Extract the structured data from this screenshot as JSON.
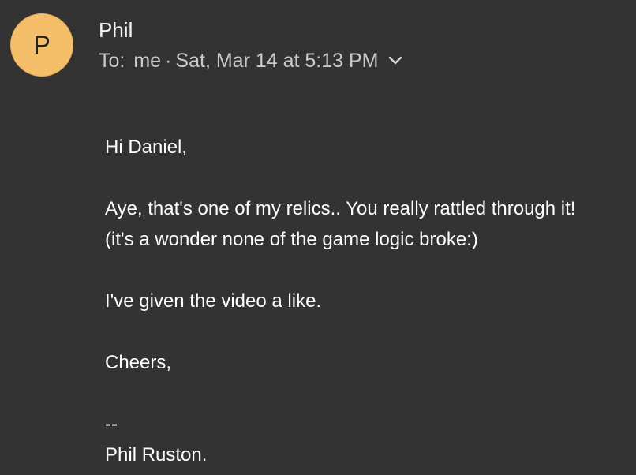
{
  "sender": {
    "avatar_letter": "P",
    "name": "Phil",
    "to_label": "To:",
    "recipient": "me",
    "separator": "·",
    "timestamp": "Sat, Mar 14 at 5:13 PM",
    "expand_icon": "chevron-down-icon"
  },
  "message": {
    "greeting": "Hi Daniel,",
    "line1": "Aye, that's one of my relics.. You really rattled through it!",
    "line2": "(it's a wonder none of the game logic broke:)",
    "line3": "I've given the video a like.",
    "signoff": "Cheers,",
    "sig_dashes": "--",
    "sig_name": "Phil Ruston."
  },
  "colors": {
    "background": "#333333",
    "avatar_bg": "#f5bf6a",
    "meta_text": "#c9c9c9"
  }
}
